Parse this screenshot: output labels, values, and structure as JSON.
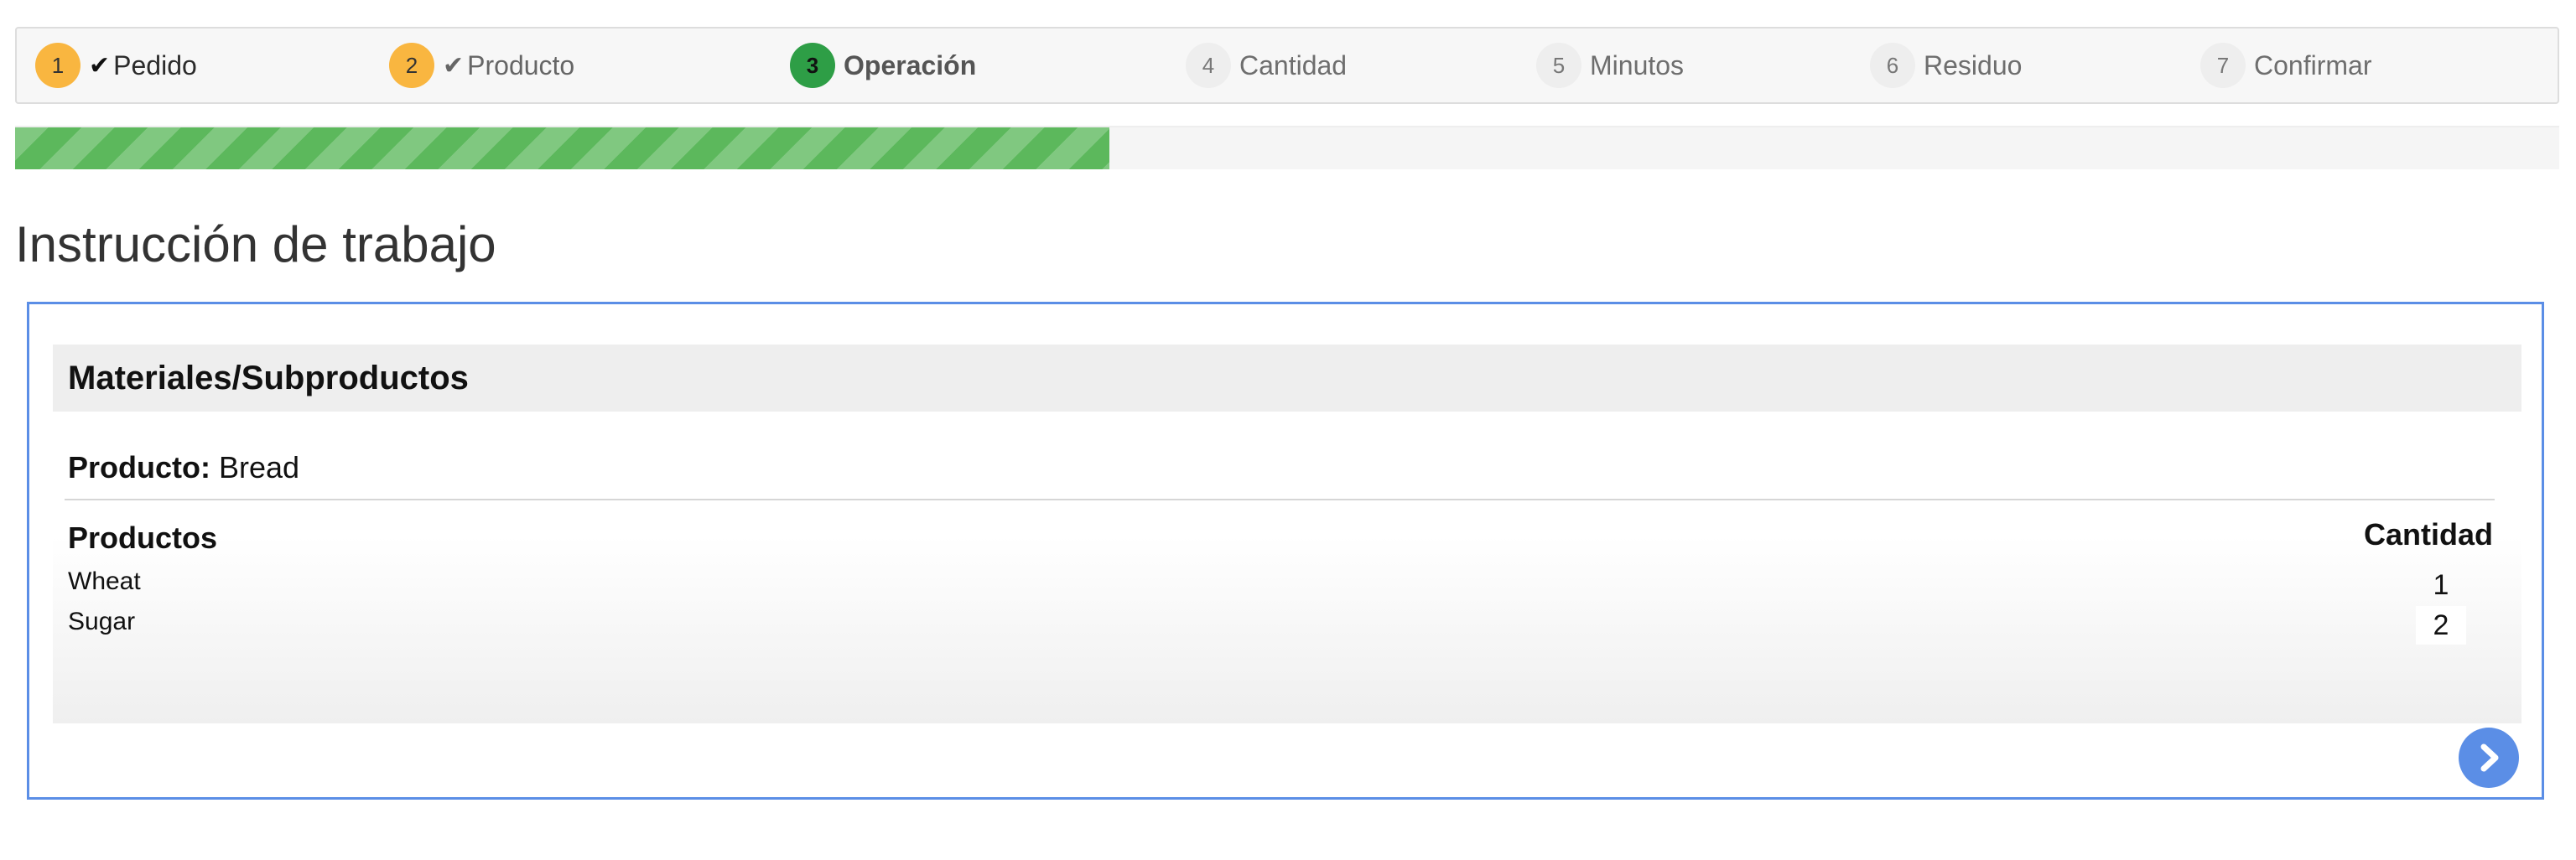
{
  "wizard": {
    "steps": [
      {
        "number": "1",
        "label": "Pedido",
        "state": "done"
      },
      {
        "number": "2",
        "label": "Producto",
        "state": "done"
      },
      {
        "number": "3",
        "label": "Operación",
        "state": "active"
      },
      {
        "number": "4",
        "label": "Cantidad",
        "state": "pending"
      },
      {
        "number": "5",
        "label": "Minutos",
        "state": "pending"
      },
      {
        "number": "6",
        "label": "Residuo",
        "state": "pending"
      },
      {
        "number": "7",
        "label": "Confirmar",
        "state": "pending"
      }
    ],
    "check_glyph": "✔",
    "progress_fraction": 0.43
  },
  "page": {
    "title": "Instrucción de trabajo"
  },
  "panel": {
    "heading": "Materiales/Subproductos",
    "product_key": "Producto:",
    "product_value": "Bread",
    "columns": {
      "products": "Productos",
      "quantity": "Cantidad"
    },
    "rows": [
      {
        "name": "Wheat",
        "quantity": "1"
      },
      {
        "name": "Sugar",
        "quantity": "2"
      }
    ]
  },
  "icons": {
    "next": "chevron-right-icon",
    "check": "check-icon"
  },
  "colors": {
    "step_done": "#f9b640",
    "step_active": "#2e9e46",
    "step_pending": "#eeeeee",
    "progress": "#5cb85c",
    "panel_border": "#5b8ee6",
    "next_button": "#5b8ee6"
  }
}
